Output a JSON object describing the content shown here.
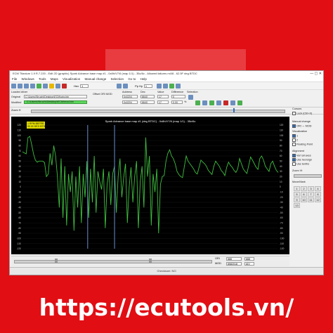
{
  "window": {
    "title": "ECM Titanium 1.9 R.7.220 - Edit 2D (graphic) Spark Advance base map #1 - 0x8h/V7/6 (map 1/1) - 35c/6c - Allowed failures m4/8 - 62.5F deg BTDC"
  },
  "menu": [
    "File",
    "Windows",
    "Tools",
    "Maps",
    "Visualization",
    "Manual change",
    "Selection",
    "Go to",
    "Help"
  ],
  "toolbar": {
    "hex_label": "Hex",
    "hex_value": "1",
    "pp_label": "Pp Hy",
    "pp_value": "1"
  },
  "loaded_driver": {
    "label": "Loaded driver",
    "original_label": "Original",
    "original_path": "C:\\Users\\Struchi\\Desktop\\ECM\\orig.bin",
    "modified_label": "Modified",
    "modified_path": "C:\\Users\\Struchi\\Desktop\\ECM\\mod.bin",
    "offset_label": "Offset ORI MOD",
    "address_label": "Address",
    "address_ori": "0x0204",
    "address_mod": "0x0204",
    "dec_label": "Dec",
    "dec_ori": "8640",
    "dec_mod": "8640",
    "value_label": "Value",
    "value_ori": "17",
    "value_mod": "17",
    "difference_label": "Difference",
    "difference_ori": "0",
    "difference_mod": "0.00",
    "difference_unit": "%",
    "selection_label": "Selection"
  },
  "zoom": {
    "label": "Zoom H"
  },
  "right_panel": {
    "cursors_label": "Cursors",
    "lock_label": "Lock (Ctrl+X)",
    "manual_change_label": "Manual change",
    "ori_mod_label": "ORI ↔ MOD",
    "visualization_label": "Visualization",
    "vis_items": [
      "1",
      "2",
      "Floating Point"
    ],
    "alignment_label": "Alignment",
    "align_items": [
      "Vert all axes",
      "Use hex/sign",
      "Use tenths"
    ],
    "zoom_label": "Zoom Vt",
    "move_label": "Move/Mark",
    "numbers": [
      "1",
      "2",
      "3",
      "4",
      "5",
      "6",
      "7",
      "8",
      "9",
      "10",
      "11",
      "12",
      "13"
    ]
  },
  "chart_data": {
    "type": "line",
    "title": "Spark Advance base map #1 (deg BTDC) - 0x8h/V7/6 (map 1/1) - 35c/6c",
    "cursor_label": "1 RPM  BEFRR\n90.00 DEG BTDC",
    "xlabel": "",
    "ylabel": "",
    "ylim": [
      -120,
      120
    ],
    "y_ticks": [
      -120,
      -110,
      -100,
      -90,
      -80,
      -70,
      -60,
      -50,
      -40,
      -30,
      -20,
      -10,
      0,
      10,
      20,
      30,
      40,
      50,
      60,
      70,
      80,
      90,
      100,
      110,
      120
    ],
    "right_ticks": [
      -120,
      -110,
      -100,
      -90,
      -80,
      -70,
      -60,
      -50,
      -40,
      -30,
      -20,
      -10,
      0,
      10,
      20,
      30,
      40,
      50,
      60,
      70,
      80,
      90,
      100,
      110,
      120
    ],
    "series": [
      {
        "values": [
          68,
          66,
          64,
          96,
          98,
          82,
          64,
          52,
          48,
          50,
          50,
          50,
          47,
          20,
          25,
          65,
          42,
          80,
          60,
          20,
          -40,
          55,
          -60,
          40,
          -75,
          25,
          -10,
          30,
          -85,
          20,
          -40,
          40,
          -70,
          25,
          -20,
          50,
          -60,
          35,
          -30,
          60,
          -50,
          30,
          10,
          -5,
          35,
          -80,
          5,
          30,
          -35,
          25,
          40,
          -50,
          20,
          55,
          -20,
          18,
          45,
          -70,
          0,
          38,
          -30,
          20,
          50,
          -80,
          10,
          40,
          -40,
          96,
          20,
          60,
          -75,
          25,
          -10,
          35,
          -90,
          5,
          20,
          22,
          50,
          65,
          72,
          60,
          55,
          45,
          30,
          24,
          20,
          18,
          40,
          60,
          50,
          45,
          40,
          35,
          28,
          25,
          38,
          52,
          48,
          45,
          40,
          32,
          28,
          24,
          40,
          50,
          45,
          40,
          32,
          28,
          22,
          38,
          48,
          42,
          38,
          32,
          28,
          35,
          55,
          45,
          35,
          30,
          26,
          42,
          58,
          52,
          45,
          38,
          34,
          55,
          60,
          52,
          40,
          35,
          30,
          45,
          50,
          40,
          32,
          28
        ]
      }
    ],
    "line_color": "#3fbf3f",
    "background": "#000000",
    "marker_x_fraction": [
      0.255,
      0.36
    ],
    "checksum_label": "Checksum: NO"
  },
  "bottom": {
    "ori_label": "ORI",
    "mod_label": "MOD",
    "ori_val": "888",
    "mod_val": "8582018",
    "ori_val2": "888",
    "mod_val2": "AIV"
  },
  "watermark": {
    "url": "https://ecutools.vn/"
  }
}
